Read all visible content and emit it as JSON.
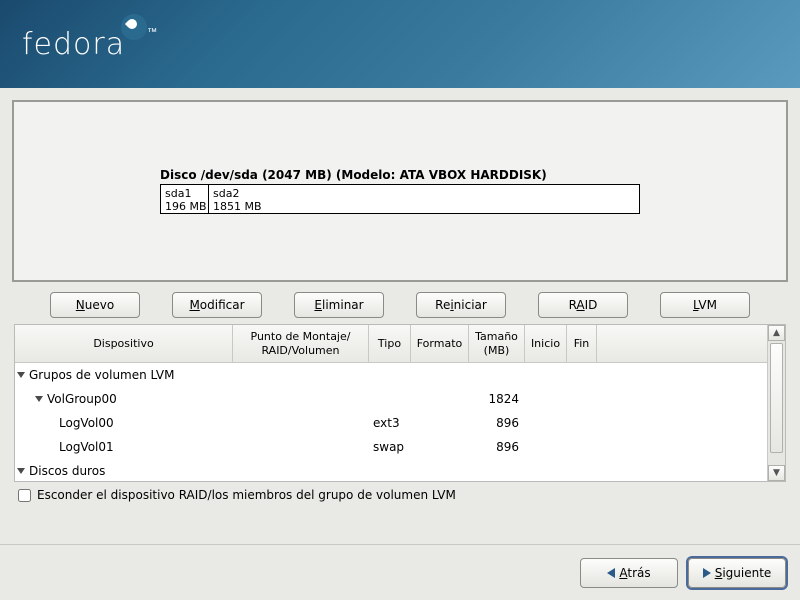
{
  "logo": "fedora",
  "disk": {
    "title": "Disco /dev/sda (2047 MB) (Modelo: ATA VBOX HARDDISK)",
    "parts": [
      {
        "name": "sda1",
        "size": "196 MB"
      },
      {
        "name": "sda2",
        "size": "1851 MB"
      }
    ]
  },
  "buttons": {
    "new": "Nuevo",
    "modify": "Modificar",
    "delete": "Eliminar",
    "reset": "Reiniciar",
    "raid": "RAID",
    "lvm": "LVM"
  },
  "columns": {
    "device": "Dispositivo",
    "mount": "Punto de Montaje/\nRAID/Volumen",
    "type": "Tipo",
    "format": "Formato",
    "size": "Tamaño\n(MB)",
    "start": "Inicio",
    "end": "Fin"
  },
  "rows": [
    {
      "level": 0,
      "expander": true,
      "device": "Grupos de volumen LVM",
      "type": "",
      "size": ""
    },
    {
      "level": 1,
      "expander": true,
      "device": "VolGroup00",
      "type": "",
      "size": "1824"
    },
    {
      "level": 2,
      "expander": false,
      "device": "LogVol00",
      "type": "ext3",
      "size": "896"
    },
    {
      "level": 2,
      "expander": false,
      "device": "LogVol01",
      "type": "swap",
      "size": "896"
    },
    {
      "level": 0,
      "expander": true,
      "device": "Discos duros",
      "type": "",
      "size": ""
    }
  ],
  "hide_raid_label": "Esconder el dispositivo RAID/los miembros del grupo de volumen LVM",
  "hide_raid_checked": false,
  "nav": {
    "back": "Atrás",
    "next": "Siguiente"
  }
}
